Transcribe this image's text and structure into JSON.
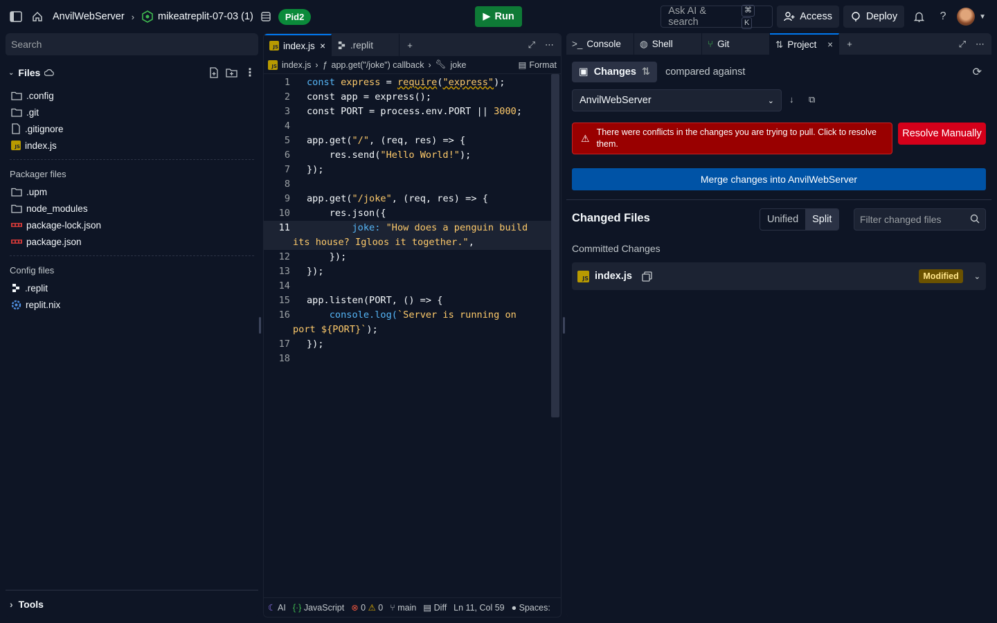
{
  "topbar": {
    "project_name": "AnvilWebServer",
    "branch_name": "mikeatreplit-07-03 (1)",
    "pid_badge": "Pid2",
    "run_label": "Run",
    "search_placeholder": "Ask AI & search",
    "kbd_cmd": "⌘",
    "kbd_k": "K",
    "access_label": "Access",
    "deploy_label": "Deploy"
  },
  "files": {
    "search_placeholder": "Search",
    "header": "Files",
    "main_items": [
      ".config",
      ".git",
      ".gitignore",
      "index.js"
    ],
    "packager_label": "Packager files",
    "packager_items": [
      ".upm",
      "node_modules",
      "package-lock.json",
      "package.json"
    ],
    "config_label": "Config files",
    "config_items": [
      ".replit",
      "replit.nix"
    ],
    "tools_label": "Tools"
  },
  "editor": {
    "tabs": [
      "index.js",
      ".replit"
    ],
    "breadcrumb": [
      "index.js",
      "app.get(\"/joke\") callback",
      "joke"
    ],
    "format_label": "Format",
    "line_numbers": [
      "1",
      "2",
      "3",
      "4",
      "5",
      "6",
      "7",
      "8",
      "9",
      "10",
      "11",
      "12",
      "13",
      "14",
      "15",
      "16",
      "17",
      "18"
    ],
    "code": {
      "l1_a": "const ",
      "l1_b": "express",
      "l1_c": " = ",
      "l1_d": "require",
      "l1_e": "(",
      "l1_f": "\"express\"",
      "l1_g": ");",
      "l2": "const app = express();",
      "l3_a": "const PORT = process.env.PORT || ",
      "l3_b": "3000",
      "l3_c": ";",
      "l5_a": "app.get(",
      "l5_b": "\"/\"",
      "l5_c": ", (req, res) => {",
      "l6_a": "    res.send(",
      "l6_b": "\"Hello World!\"",
      "l6_c": ");",
      "l7": "});",
      "l9_a": "app.get(",
      "l9_b": "\"/joke\"",
      "l9_c": ", (req, res) => {",
      "l10": "    res.json({",
      "l11_a": "        joke: ",
      "l11_b": "\"How does a penguin build",
      "l11_c": "its house? Igloos it together.\"",
      "l11_d": ",",
      "l12": "    });",
      "l13": "});",
      "l15": "app.listen(PORT, () => {",
      "l16_a": "    console.log(",
      "l16_b": "`Server is running on",
      "l16_c": "port ${PORT}`",
      "l16_d": ");",
      "l17": "});"
    },
    "status": {
      "ai": "AI",
      "language": "JavaScript",
      "errors": "0",
      "warnings": "0",
      "branch": "main",
      "diff": "Diff",
      "position": "Ln 11, Col 59",
      "spaces": "Spaces:"
    }
  },
  "git": {
    "tabs": [
      "Console",
      "Shell",
      "Git",
      "Project"
    ],
    "changes_label": "Changes",
    "compared_label": "compared against",
    "branch_select": "AnvilWebServer",
    "conflict_text": "There were conflicts in the changes you are trying to pull. Click to resolve them.",
    "resolve_label": "Resolve Manually",
    "merge_label": "Merge changes into AnvilWebServer",
    "changed_files_title": "Changed Files",
    "view_unified": "Unified",
    "view_split": "Split",
    "filter_placeholder": "Filter changed files",
    "committed_label": "Committed Changes",
    "file_name": "index.js",
    "file_status": "Modified"
  }
}
